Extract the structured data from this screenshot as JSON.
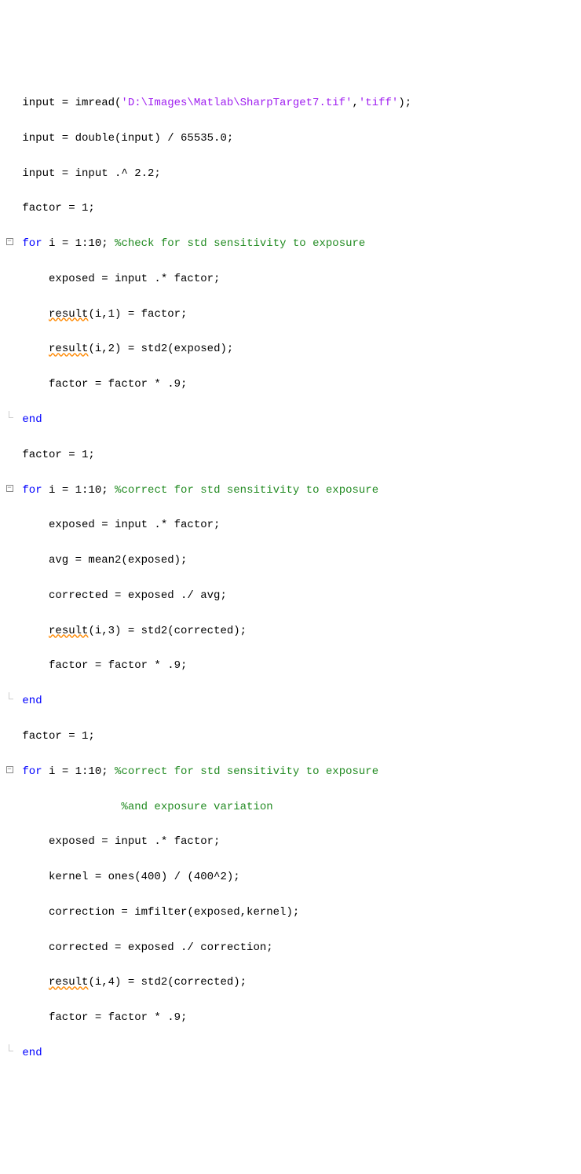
{
  "lines": {
    "l1_a": " input = imread(",
    "l1_s1": "'D:\\Images\\Matlab\\SharpTarget7.tif'",
    "l1_b": ",",
    "l1_s2": "'tiff'",
    "l1_c": ");",
    "l2": " input = double(input) / 65535.0;",
    "l3": " input = input .^ 2.2;",
    "l4": " factor = 1;",
    "l5_kw": "for",
    "l5_a": " i = 1:10; ",
    "l5_com": "%check for std sensitivity to exposure",
    "l6": "     exposed = input .* factor;",
    "l7_a": "     ",
    "l7_w": "result",
    "l7_b": "(i,1) = factor;",
    "l8_a": "     ",
    "l8_w": "result",
    "l8_b": "(i,2) = std2(exposed);",
    "l9": "     factor = factor * .9;",
    "l10": " ",
    "l10_kw": "end",
    "l11": " factor = 1;",
    "l12_kw": "for",
    "l12_a": " i = 1:10; ",
    "l12_com": "%correct for std sensitivity to exposure",
    "l13": "     exposed = input .* factor;",
    "l14": "     avg = mean2(exposed);",
    "l15": "     corrected = exposed ./ avg;",
    "l16_a": "     ",
    "l16_w": "result",
    "l16_b": "(i,3) = std2(corrected);",
    "l17": "     factor = factor * .9;",
    "l18": " ",
    "l18_kw": "end",
    "l19": " factor = 1;",
    "l20_kw": "for",
    "l20_a": " i = 1:10; ",
    "l20_com": "%correct for std sensitivity to exposure",
    "l21_pad": "                ",
    "l21_com": "%and exposure variation",
    "l22": "     exposed = input .* factor;",
    "l23": "     kernel = ones(400) / (400^2);",
    "l24": "     correction = imfilter(exposed,kernel);",
    "l25": "     corrected = exposed ./ correction;",
    "l26_a": "     ",
    "l26_w": "result",
    "l26_b": "(i,4) = std2(corrected);",
    "l27": "     factor = factor * .9;",
    "l28": " ",
    "l28_kw": "end"
  }
}
